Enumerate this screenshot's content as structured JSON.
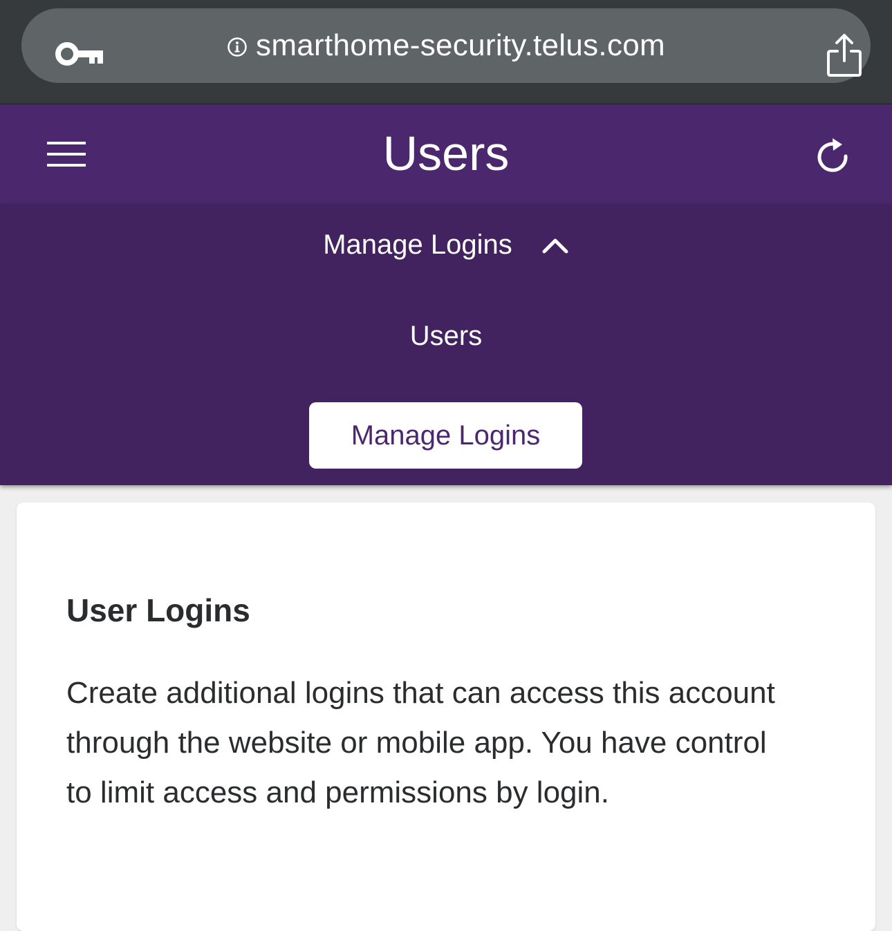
{
  "browser": {
    "url": "smarthome-security.telus.com",
    "icons": {
      "key": "key-icon",
      "info": "info-icon",
      "share": "share-icon"
    }
  },
  "header": {
    "title": "Users",
    "menu_icon": "hamburger-menu-icon",
    "refresh_icon": "refresh-icon",
    "background": "#4b286d"
  },
  "submenu": {
    "toggle_label": "Manage Logins",
    "toggle_icon": "chevron-up-icon",
    "items": [
      {
        "label": "Users"
      }
    ],
    "active_button": "Manage Logins",
    "background": "#42225f"
  },
  "card": {
    "heading": "User Logins",
    "description": "Create additional logins that can access this account through the website or mobile app. You have control to limit access and permissions by login."
  }
}
